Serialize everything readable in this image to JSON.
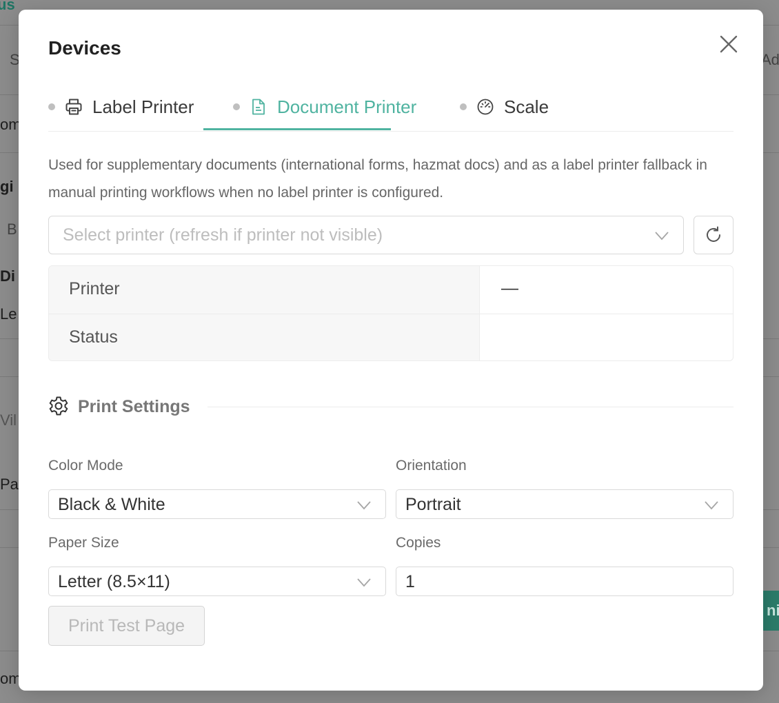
{
  "background": {
    "texts": [
      "us",
      "S",
      "Ad",
      "om",
      "gi",
      "B",
      "Di",
      "Le",
      "Vil",
      "Pa",
      "nip",
      "om"
    ]
  },
  "modal": {
    "title": "Devices",
    "close_icon": "close-icon",
    "tabs": [
      {
        "label": "Label Printer",
        "icon": "printer-icon",
        "active": false
      },
      {
        "label": "Document Printer",
        "icon": "document-icon",
        "active": true
      },
      {
        "label": "Scale",
        "icon": "gauge-icon",
        "active": false
      }
    ],
    "description": "Used for supplementary documents (international forms, hazmat docs) and as a label printer fallback in manual printing workflows when no label printer is configured.",
    "printer_select": {
      "placeholder": "Select printer (refresh if printer not visible)"
    },
    "info": {
      "printer_label": "Printer",
      "printer_value": "—",
      "status_label": "Status",
      "status_value": ""
    },
    "print_settings": {
      "heading": "Print Settings",
      "color_mode_label": "Color Mode",
      "color_mode_value": "Black & White",
      "orientation_label": "Orientation",
      "orientation_value": "Portrait",
      "paper_size_label": "Paper Size",
      "paper_size_value": "Letter (8.5×11)",
      "copies_label": "Copies",
      "copies_value": "1"
    },
    "print_test_label": "Print Test Page"
  },
  "colors": {
    "accent": "#4fb3a0",
    "overlay": "#8c8c8c"
  }
}
